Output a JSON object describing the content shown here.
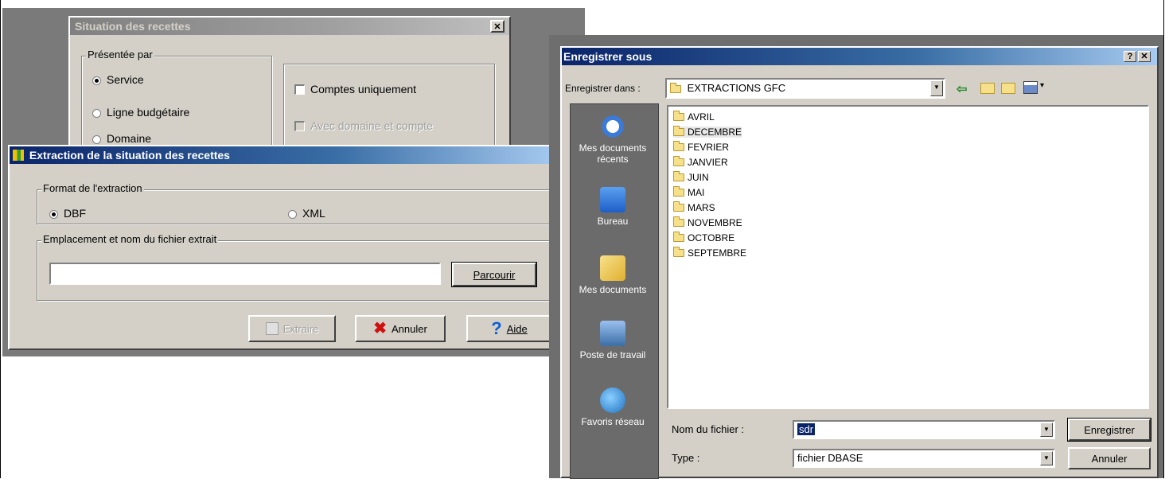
{
  "situation": {
    "title": "Situation des recettes",
    "close_label": "✕",
    "presentee_par": {
      "legend": "Présentée par",
      "options": [
        "Service",
        "Ligne budgétaire",
        "Domaine"
      ],
      "selected": 0
    },
    "comptes_uniquement": "Comptes uniquement",
    "avec_domaine": "Avec domaine et compte"
  },
  "extraction": {
    "title": "Extraction de la situation des recettes",
    "format_legend": "Format de l'extraction",
    "format_dbf": "DBF",
    "format_xml": "XML",
    "emplacement_legend": "Emplacement et nom du fichier extrait",
    "path_value": "",
    "parcourir_label": "Parcourir",
    "extraire_label": "Extraire",
    "annuler_label": "Annuler",
    "aide_label": "Aide"
  },
  "save_dialog": {
    "title": "Enregistrer sous",
    "help_label": "?",
    "close_label": "✕",
    "save_in_label": "Enregistrer dans :",
    "save_in_value": "EXTRACTIONS GFC",
    "places": [
      "Mes documents récents",
      "Bureau",
      "Mes documents",
      "Poste de travail",
      "Favoris réseau"
    ],
    "folders": [
      "AVRIL",
      "DECEMBRE",
      "FEVRIER",
      "JANVIER",
      "JUIN",
      "MAI",
      "MARS",
      "NOVEMBRE",
      "OCTOBRE",
      "SEPTEMBRE"
    ],
    "filename_label": "Nom du fichier :",
    "filename_value": "sdr",
    "type_label": "Type :",
    "type_value": "fichier DBASE",
    "save_button": "Enregistrer",
    "cancel_button": "Annuler"
  },
  "colors": {
    "dialog_face": "#d4d0c8",
    "title_active": "#0a246a",
    "places_bar": "#6b6b6b"
  }
}
